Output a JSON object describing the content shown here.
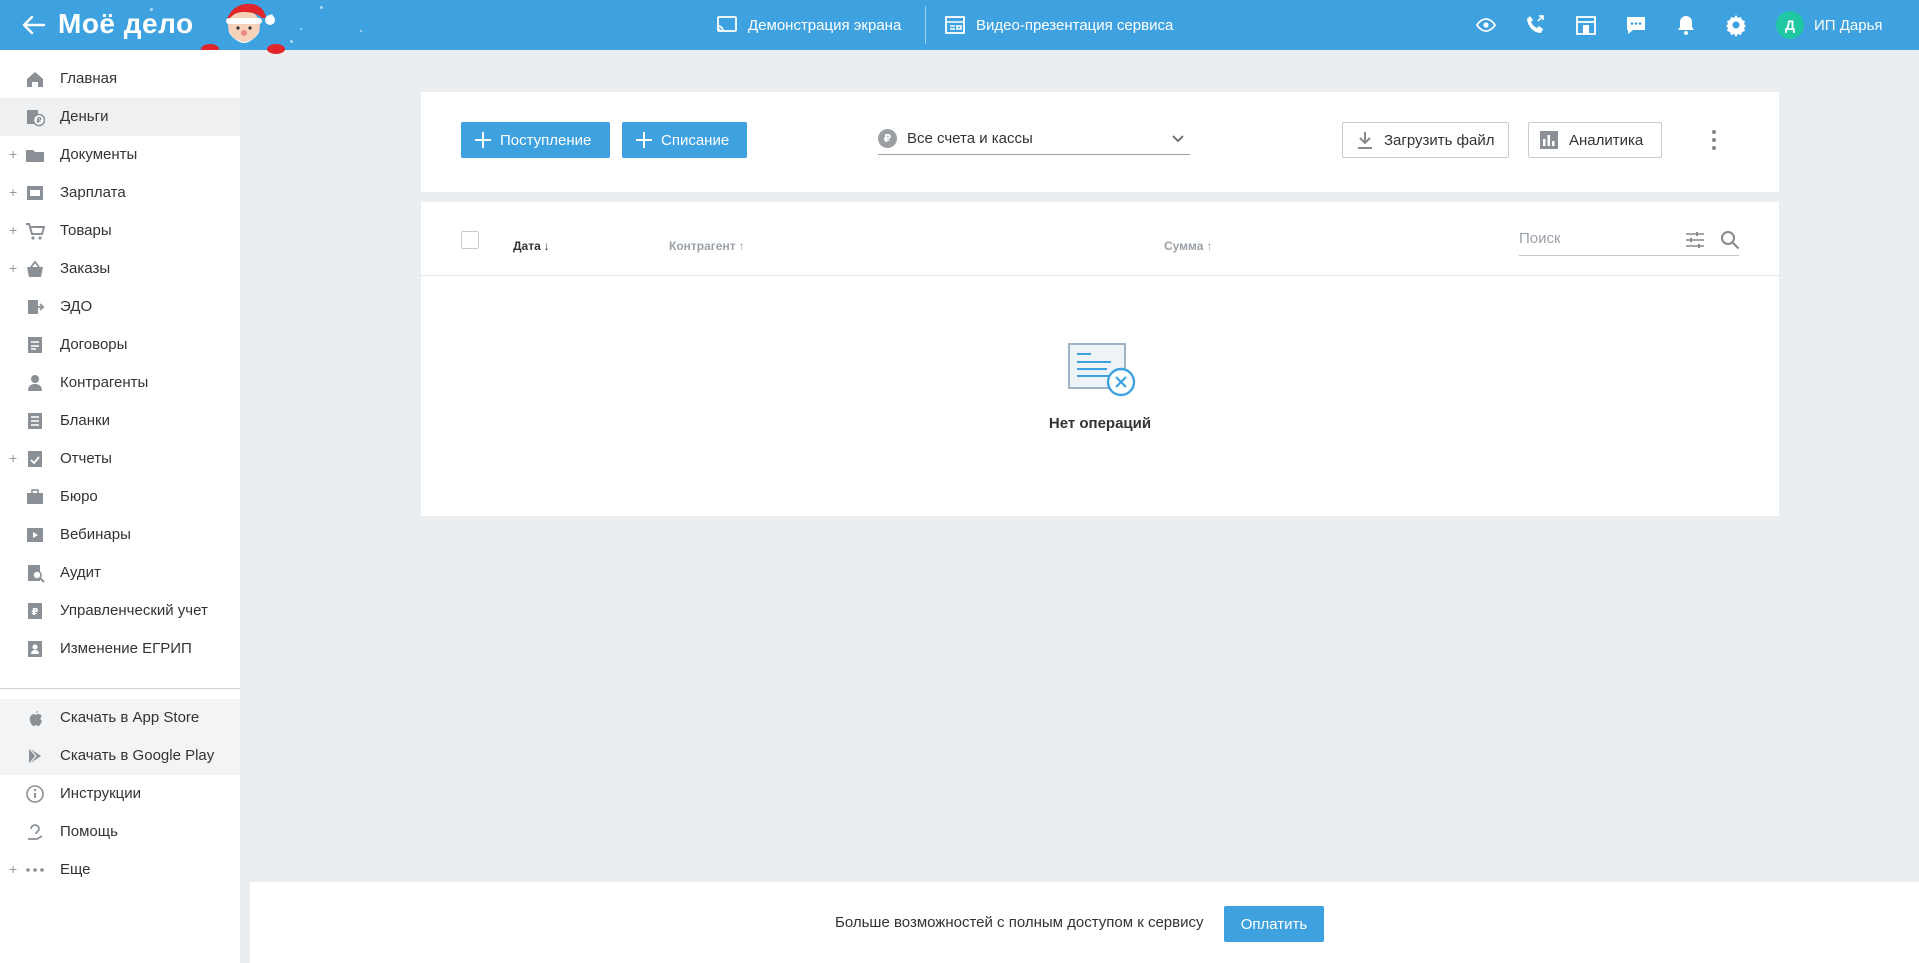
{
  "header": {
    "logo": "Моё дело",
    "screen_demo": "Демонстрация экрана",
    "video_presentation": "Видео-презентация сервиса",
    "user_initial": "Д",
    "user_name": "ИП Дарья",
    "icons": [
      "eye-icon",
      "phone-icon",
      "store-icon",
      "chat-icon",
      "bell-icon",
      "gear-icon"
    ]
  },
  "sidebar": {
    "items": [
      {
        "label": "Главная",
        "icon": "home-icon",
        "expandable": false
      },
      {
        "label": "Деньги",
        "icon": "money-icon",
        "expandable": false,
        "active": true
      },
      {
        "label": "Документы",
        "icon": "folder-icon",
        "expandable": true
      },
      {
        "label": "Зарплата",
        "icon": "salary-icon",
        "expandable": true
      },
      {
        "label": "Товары",
        "icon": "cart-icon",
        "expandable": true
      },
      {
        "label": "Заказы",
        "icon": "basket-icon",
        "expandable": true
      },
      {
        "label": "ЭДО",
        "icon": "edo-icon",
        "expandable": false
      },
      {
        "label": "Договоры",
        "icon": "contract-icon",
        "expandable": false
      },
      {
        "label": "Контрагенты",
        "icon": "person-icon",
        "expandable": false
      },
      {
        "label": "Бланки",
        "icon": "forms-icon",
        "expandable": false
      },
      {
        "label": "Отчеты",
        "icon": "report-icon",
        "expandable": true
      },
      {
        "label": "Бюро",
        "icon": "briefcase-icon",
        "expandable": false
      },
      {
        "label": "Вебинары",
        "icon": "webinar-icon",
        "expandable": false
      },
      {
        "label": "Аудит",
        "icon": "audit-icon",
        "expandable": false
      },
      {
        "label": "Управленческий учет",
        "icon": "management-icon",
        "expandable": false
      },
      {
        "label": "Изменение ЕГРИП",
        "icon": "egrip-icon",
        "expandable": false
      }
    ],
    "bottom_items": [
      {
        "label": "Скачать в App Store",
        "icon": "apple-icon",
        "expandable": false
      },
      {
        "label": "Скачать в Google Play",
        "icon": "google-play-icon",
        "expandable": false
      },
      {
        "label": "Инструкции",
        "icon": "info-icon",
        "expandable": false
      },
      {
        "label": "Помощь",
        "icon": "help-icon",
        "expandable": false
      },
      {
        "label": "Еще",
        "icon": "more-dots-icon",
        "expandable": true
      }
    ]
  },
  "toolbar": {
    "income_label": "Поступление",
    "expense_label": "Списание",
    "account_select": "Все счета и кассы",
    "ruble_symbol": "₽",
    "upload_label": "Загрузить файл",
    "analytics_label": "Аналитика"
  },
  "table": {
    "col_date": "Дата",
    "col_date_sort": "↓",
    "col_contractor": "Контрагент",
    "col_contractor_sort": "↑",
    "col_sum": "Сумма",
    "col_sum_sort": "↑",
    "search_placeholder": "Поиск",
    "empty_text": "Нет операций"
  },
  "banner": {
    "text": "Больше возможностей с полным доступом к сервису",
    "pay_label": "Оплатить"
  },
  "colors": {
    "brand": "#3fa2e0",
    "avatar": "#1fc7a3",
    "background": "#ebeef1"
  }
}
